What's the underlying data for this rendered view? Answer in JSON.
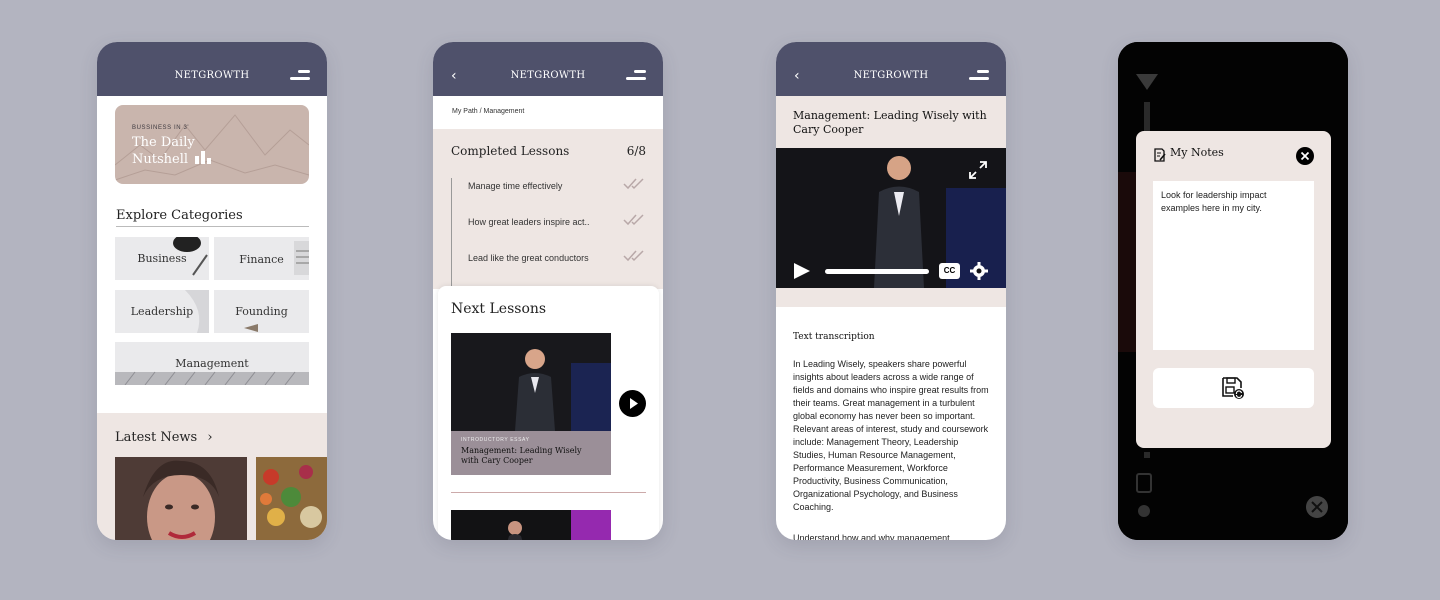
{
  "brand": "NETGROWTH",
  "colors": {
    "header": "#4f516b",
    "tint": "#eee6e3",
    "page_bg": "#b3b4c0"
  },
  "screen1": {
    "menu_icon": "hamburger-icon",
    "nutshell": {
      "subtitle": "BUSSINESS IN 3'",
      "title": "The Daily Nutshell"
    },
    "explore_title": "Explore Categories",
    "categories": [
      "Business",
      "Finance",
      "Leadership",
      "Founding",
      "Management"
    ],
    "latest_news": "Latest News"
  },
  "screen2": {
    "breadcrumb": "My Path / Management",
    "completed_title": "Completed Lessons",
    "completed_count": "6/8",
    "completed": [
      "Manage time effectively",
      "How great leaders inspire act..",
      "Lead like the great conductors"
    ],
    "next_title": "Next Lessons",
    "next_kicker": "INTRODUCTORY ESSAY",
    "next_lesson": "Management: Leading Wisely with Cary Cooper"
  },
  "screen3": {
    "title": "Management: Leading Wisely with Cary Cooper",
    "cc_label": "CC",
    "video_progress": 1.0,
    "transcription_heading": "Text transcription",
    "transcription": "In Leading Wisely, speakers share powerful insights about leaders across a wide range of fields and domains who inspire great results from their teams. Great management in a turbulent global economy has never been so important. Relevant areas of interest, study and coursework include: Management Theory, Leadership Studies, Human Resource Management, Performance Measurement, Workforce Productivity, Business Communication, Organizational Psychology, and Business Coaching.",
    "transcription_more": "Understand how and why management"
  },
  "screen4": {
    "notes_title": "My Notes",
    "note_text": "Look for leadership impact examples here in my city."
  }
}
